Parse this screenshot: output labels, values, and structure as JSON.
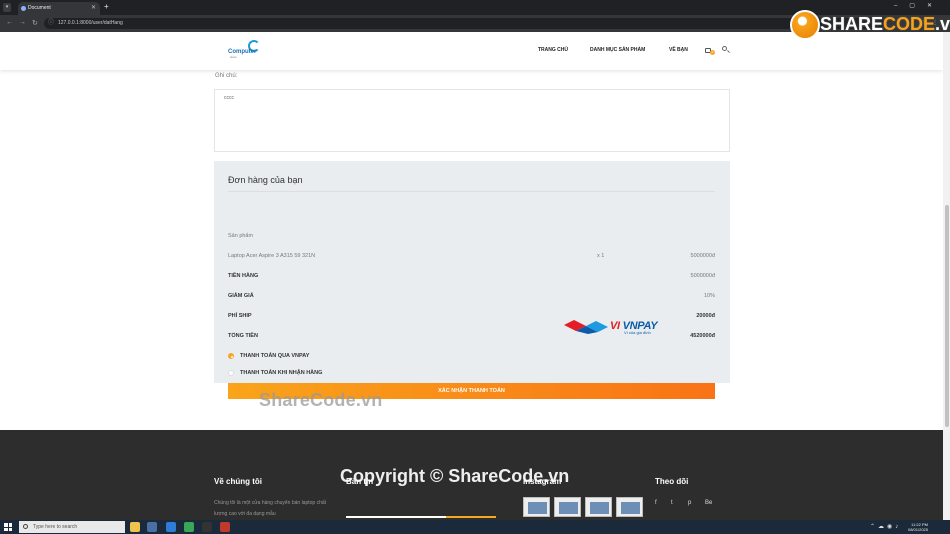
{
  "browser": {
    "tab_title": "Document",
    "url": "127.0.0.1:8000/user/datHang"
  },
  "header": {
    "logo_text": "Computer",
    "logo_sub": "store",
    "nav": [
      "TRANG CHỦ",
      "DANH MỤC SẢN PHẨM",
      "VỀ BẠN"
    ],
    "cart_count": "0"
  },
  "note": {
    "label": "Ghi chú:",
    "value": "cccc"
  },
  "order": {
    "title": "Đơn hàng của bạn",
    "product_header": "Sản phẩm",
    "item": {
      "name": "Laptop Acer Aspire 3 A315 59 321N",
      "qty": "x 1",
      "price": "5000000đ"
    },
    "subtotal_label": "TIỀN HÀNG",
    "subtotal": "5000000đ",
    "discount_label": "GIẢM GIÁ",
    "discount": "10%",
    "ship_label": "PHÍ SHIP",
    "ship": "20000đ",
    "total_label": "TỔNG TIỀN",
    "total": "4520000đ",
    "pay_vnpay": "THANH TOÁN QUA VNPAY",
    "pay_cod": "THANH TOÁN KHI NHẬN HÀNG",
    "vnpay_logo": {
      "text_a": "VI ",
      "text_b": "VNPAY",
      "tagline": "Ví của gia đình"
    },
    "submit": "XÁC NHẬN THANH TOÁN"
  },
  "watermarks": {
    "center": "ShareCode.vn",
    "bottom": "Copyright © ShareCode.vn",
    "logo_a": "SHARE",
    "logo_b": "CODE",
    "logo_c": ".vn"
  },
  "footer": {
    "about_title": "Về chúng tôi",
    "about_text": "Chúng tôi là một cửa hàng chuyên bán laptop chất lượng cao với đa dạng mẫu",
    "news_title": "Bản tin",
    "insta_title": "Instagram",
    "follow_title": "Theo dõi",
    "social": [
      "f",
      "t",
      "p",
      "Be"
    ]
  },
  "taskbar": {
    "search_placeholder": "Type here to search",
    "time": "11:22 PM",
    "date": "08/01/2025"
  },
  "colors": {
    "accent": "#f5a623",
    "order_bg": "#e9edf0",
    "footer_bg": "#2d2d2d"
  }
}
